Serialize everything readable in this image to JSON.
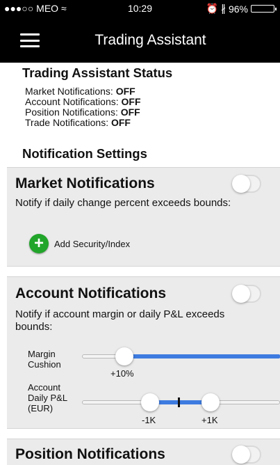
{
  "status_bar": {
    "carrier": "●●●○○ MEO ≈",
    "time": "10:29",
    "battery": "96%",
    "battery_level": 0.96
  },
  "header": {
    "title": "Trading Assistant"
  },
  "status_section": {
    "title": "Trading Assistant Status",
    "items": [
      {
        "label": "Market Notifications:",
        "value": "OFF"
      },
      {
        "label": "Account Notifications:",
        "value": "OFF"
      },
      {
        "label": "Position Notifications:",
        "value": "OFF"
      },
      {
        "label": "Trade Notifications:",
        "value": "OFF"
      }
    ]
  },
  "settings_section": {
    "title": "Notification Settings"
  },
  "market_card": {
    "title": "Market Notifications",
    "description": "Notify if daily change percent exceeds bounds:",
    "enabled": false,
    "add_button_label": "Add Security/Index"
  },
  "account_card": {
    "title": "Account Notifications",
    "description": "Notify if account margin or daily P&L exceeds bounds:",
    "enabled": false,
    "margin_slider": {
      "label_line1": "Margin",
      "label_line2": "Cushion",
      "value_label": "+10%"
    },
    "pnl_slider": {
      "label_line1": "Account",
      "label_line2": "Daily P&L",
      "label_line3": "(EUR)",
      "low_label": "-1K",
      "high_label": "+1K"
    }
  },
  "position_card": {
    "title": "Position Notifications",
    "enabled": false
  },
  "colors": {
    "accent_blue": "#3d7be0",
    "add_green": "#21a52a",
    "card_bg": "#ebebeb"
  }
}
